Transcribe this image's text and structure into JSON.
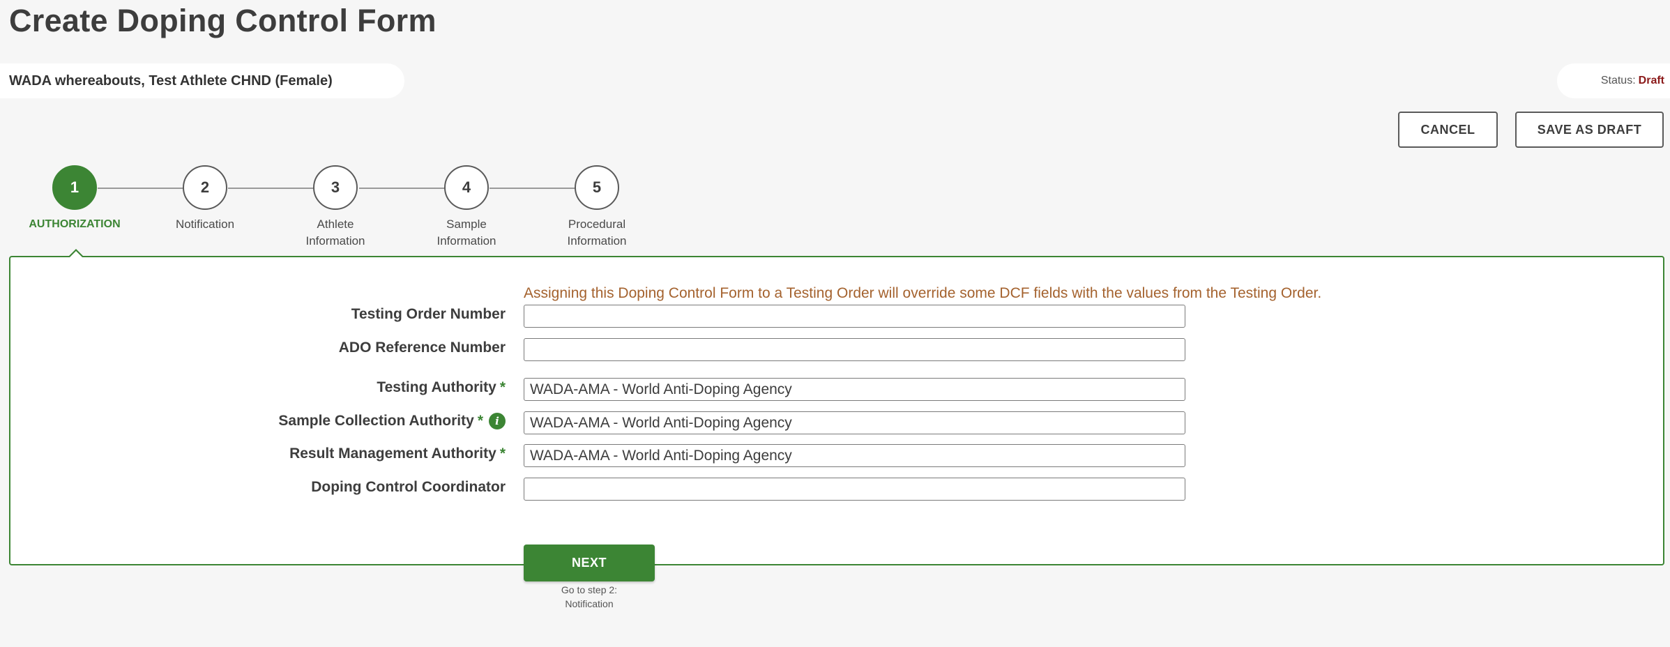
{
  "page": {
    "title": "Create Doping Control Form",
    "athlete": "WADA whereabouts, Test Athlete CHND (Female)",
    "status_label": "Status:",
    "status_value": "Draft"
  },
  "actions": {
    "cancel_label": "CANCEL",
    "save_draft_label": "SAVE AS DRAFT"
  },
  "steps": [
    {
      "number": "1",
      "label": "AUTHORIZATION",
      "active": true
    },
    {
      "number": "2",
      "label": "Notification",
      "active": false
    },
    {
      "number": "3",
      "label_line1": "Athlete",
      "label_line2": "Information",
      "active": false
    },
    {
      "number": "4",
      "label_line1": "Sample",
      "label_line2": "Information",
      "active": false
    },
    {
      "number": "5",
      "label_line1": "Procedural",
      "label_line2": "Information",
      "active": false
    }
  ],
  "form": {
    "notice": "Assigning this Doping Control Form to a Testing Order will override some DCF fields with the values from the Testing Order.",
    "required_mark": "*",
    "info_glyph": "i",
    "fields": [
      {
        "label": "Testing Order Number",
        "value": "",
        "required": false
      },
      {
        "label": "ADO Reference Number",
        "value": "",
        "required": false
      },
      {
        "label": "Testing Authority",
        "value": "WADA-AMA - World Anti-Doping Agency",
        "required": true
      },
      {
        "label": "Sample Collection Authority",
        "value": "WADA-AMA - World Anti-Doping Agency",
        "required": true,
        "info": true
      },
      {
        "label": "Result Management Authority",
        "value": "WADA-AMA - World Anti-Doping Agency",
        "required": true
      },
      {
        "label": "Doping Control Coordinator",
        "value": "",
        "required": false
      }
    ]
  },
  "next": {
    "label": "NEXT",
    "hint_line1": "Go to step 2:",
    "hint_line2": "Notification"
  },
  "colors": {
    "accent_green": "#3c8534",
    "notice_brown": "#a4622e",
    "status_red": "#8b1a1a"
  }
}
